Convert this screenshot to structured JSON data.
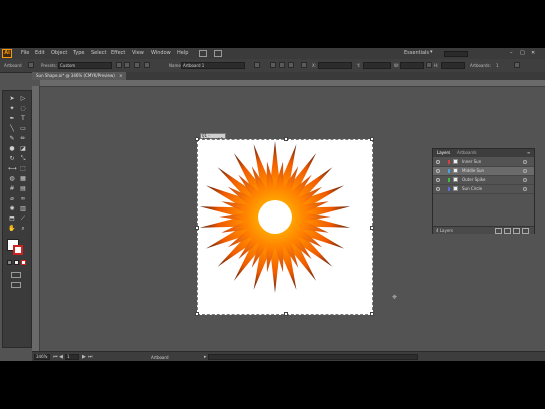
{
  "menubar": {
    "logo": "Ai",
    "items": [
      "File",
      "Edit",
      "Object",
      "Type",
      "Select",
      "Effect",
      "View",
      "Window",
      "Help"
    ],
    "workspace": "Essentials"
  },
  "control_bar": {
    "selection": "Artboard",
    "presets_label": "Presets:",
    "presets_value": "Custom",
    "name_label": "Name:",
    "name_value": "Artboard 1",
    "x_label": "X:",
    "y_label": "Y:",
    "w_label": "W:",
    "h_label": "H:",
    "artboards_label": "Artboards:",
    "artboards_value": "1"
  },
  "document_tab": {
    "title": "Sun Shape.ai* @ 346% (CMYK/Preview)"
  },
  "artboard": {
    "label": "01 - Artboard 1"
  },
  "layers_panel": {
    "tabs": [
      "Layers",
      "Artboards"
    ],
    "rows": [
      {
        "name": "Inner Sun",
        "color": "#d94040"
      },
      {
        "name": "Middle Sun",
        "color": "#4aa0e0"
      },
      {
        "name": "Outer Spike",
        "color": "#3fbf3f"
      },
      {
        "name": "Sun Circle",
        "color": "#5a6be0"
      }
    ],
    "footer": "4 Layers"
  },
  "status_bar": {
    "zoom": "346%",
    "page": "1",
    "tool": "Artboard"
  },
  "colors": {
    "accent": "#ff9a00",
    "sun_inner": "#ffb000",
    "sun_mid": "#ff6a00",
    "sun_dark": "#7a2a10"
  }
}
